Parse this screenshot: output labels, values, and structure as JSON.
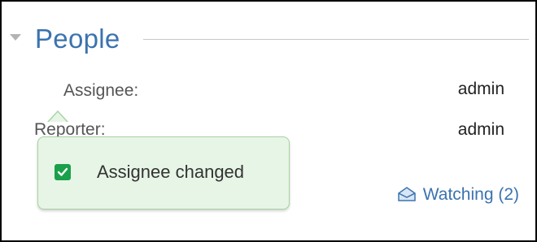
{
  "section": {
    "title": "People"
  },
  "fields": [
    {
      "label": "Assignee:",
      "value": "admin"
    },
    {
      "label": "Reporter:",
      "value": "admin"
    }
  ],
  "watch": {
    "label": "Watching (2)",
    "icon": "envelope-icon"
  },
  "flag": {
    "message": "Assignee changed",
    "icon": "checkbox-check-icon",
    "color": "#19a04b"
  },
  "colors": {
    "link": "#3b73af",
    "flag_bg": "#e7f5e6"
  }
}
